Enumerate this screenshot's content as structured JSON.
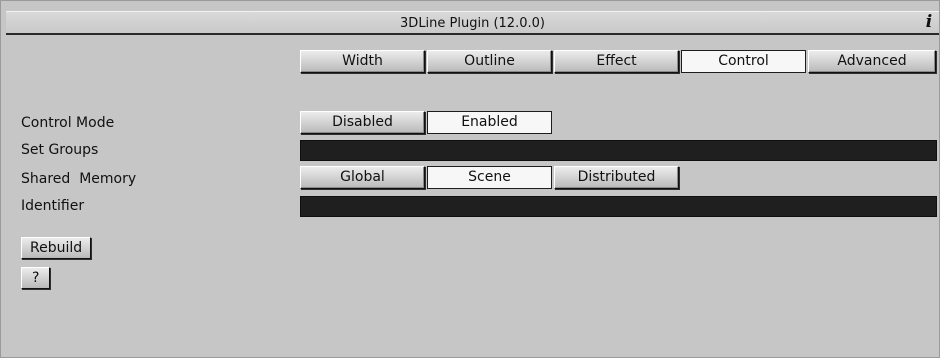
{
  "window": {
    "title": "3DLine Plugin (12.0.0)",
    "info_icon": "i"
  },
  "tabs": [
    {
      "label": "Width",
      "active": false
    },
    {
      "label": "Outline",
      "active": false
    },
    {
      "label": "Effect",
      "active": false
    },
    {
      "label": "Control",
      "active": true
    },
    {
      "label": "Advanced",
      "active": false
    }
  ],
  "rows": {
    "control_mode": {
      "label": "Control Mode",
      "options": [
        "Disabled",
        "Enabled"
      ],
      "selected": "Enabled"
    },
    "set_groups": {
      "label": "Set Groups",
      "value": ""
    },
    "shared_memory": {
      "label": "Shared  Memory",
      "options": [
        "Global",
        "Scene",
        "Distributed"
      ],
      "selected": "Scene"
    },
    "identifier": {
      "label": "Identifier",
      "value": ""
    }
  },
  "actions": {
    "rebuild_label": "Rebuild",
    "help_label": "?"
  },
  "colors": {
    "panel_bg": "#c6c6c6",
    "field_bg": "#1f1f1f",
    "active_button_bg": "#f7f7f7"
  }
}
